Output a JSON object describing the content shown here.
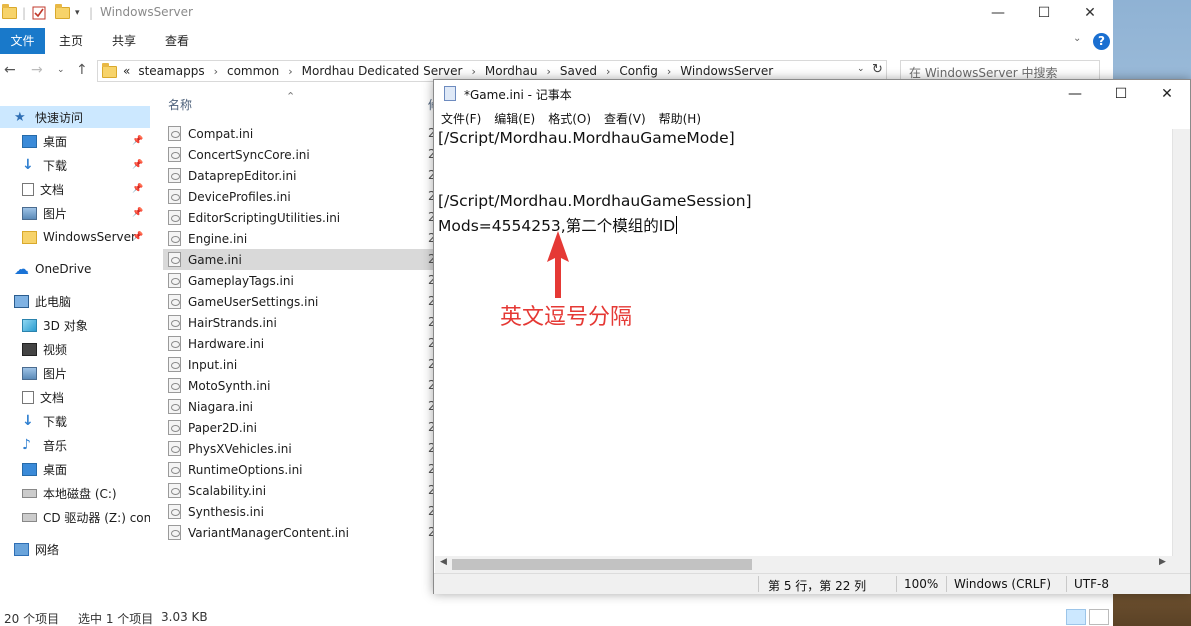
{
  "explorer": {
    "title": "WindowsServer",
    "window_controls": {
      "minimize": "—",
      "maximize": "☐",
      "close": "✕"
    },
    "ribbon_tabs": [
      "文件",
      "主页",
      "共享",
      "查看"
    ],
    "help": "?",
    "breadcrumb": [
      "steamapps",
      "common",
      "Mordhau Dedicated Server",
      "Mordhau",
      "Saved",
      "Config",
      "WindowsServer"
    ],
    "breadcrumb_lead": "«",
    "search_placeholder": "在 WindowsServer 中搜索",
    "column_name": "名称",
    "column_date_partial": "修",
    "nav": [
      {
        "label": "快速访问",
        "icon": "star-icon"
      },
      {
        "label": "桌面",
        "icon": "desktop-icon",
        "pinned": true
      },
      {
        "label": "下载",
        "icon": "download-icon",
        "pinned": true
      },
      {
        "label": "文档",
        "icon": "document-icon",
        "pinned": true
      },
      {
        "label": "图片",
        "icon": "picture-icon",
        "pinned": true
      },
      {
        "label": "WindowsServer",
        "icon": "folder-icon",
        "pinned": true
      },
      {
        "label": "OneDrive",
        "icon": "cloud-icon"
      },
      {
        "label": "此电脑",
        "icon": "computer-icon"
      },
      {
        "label": "3D 对象",
        "icon": "cube-icon"
      },
      {
        "label": "视频",
        "icon": "video-icon"
      },
      {
        "label": "图片",
        "icon": "picture-icon"
      },
      {
        "label": "文档",
        "icon": "document-icon"
      },
      {
        "label": "下载",
        "icon": "download-icon"
      },
      {
        "label": "音乐",
        "icon": "music-icon"
      },
      {
        "label": "桌面",
        "icon": "desktop-icon"
      },
      {
        "label": "本地磁盘 (C:)",
        "icon": "drive-icon"
      },
      {
        "label": "CD 驱动器 (Z:) con",
        "icon": "cd-icon"
      },
      {
        "label": "网络",
        "icon": "network-icon"
      }
    ],
    "files": [
      "Compat.ini",
      "ConcertSyncCore.ini",
      "DataprepEditor.ini",
      "DeviceProfiles.ini",
      "EditorScriptingUtilities.ini",
      "Engine.ini",
      "Game.ini",
      "GameplayTags.ini",
      "GameUserSettings.ini",
      "HairStrands.ini",
      "Hardware.ini",
      "Input.ini",
      "MotoSynth.ini",
      "Niagara.ini",
      "Paper2D.ini",
      "PhysXVehicles.ini",
      "RuntimeOptions.ini",
      "Scalability.ini",
      "Synthesis.ini",
      "VariantManagerContent.ini"
    ],
    "date_prefix": "2",
    "status": {
      "count": "20 个项目",
      "selected": "选中 1 个项目",
      "size": "3.03 KB"
    }
  },
  "notepad": {
    "title": "*Game.ini - 记事本",
    "menu": [
      "文件(F)",
      "编辑(E)",
      "格式(O)",
      "查看(V)",
      "帮助(H)"
    ],
    "lines": [
      "[/Script/Mordhau.MordhauGameMode]",
      "",
      "",
      "[/Script/Mordhau.MordhauGameSession]",
      "Mods=4554253,第二个模组的ID"
    ],
    "status": {
      "position": "第 5 行，第 22 列",
      "zoom": "100%",
      "line_ending": "Windows (CRLF)",
      "encoding": "UTF-8"
    }
  },
  "annotation": {
    "text": "英文逗号分隔",
    "color": "#e53935"
  },
  "colors": {
    "ribbon_file": "#1979ca",
    "selected_nav": "#cce8ff",
    "selected_file": "#d9d9d9"
  }
}
